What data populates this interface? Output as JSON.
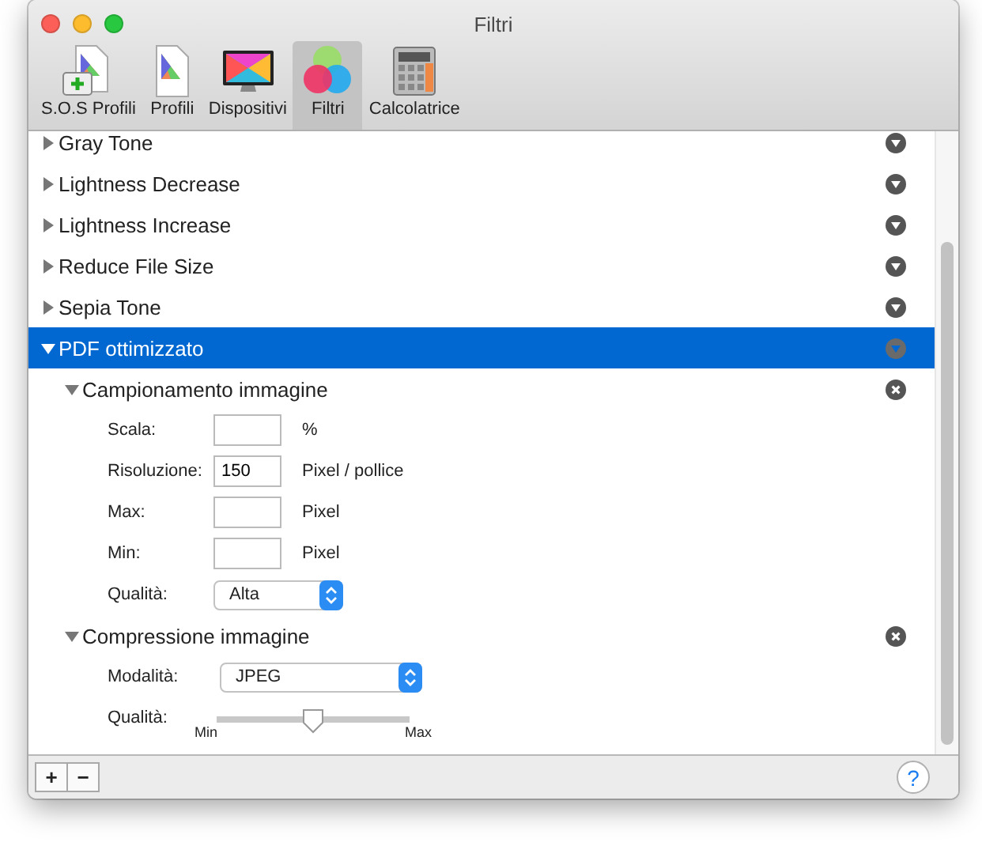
{
  "window": {
    "title": "Filtri"
  },
  "toolbar": {
    "items": [
      {
        "label": "S.O.S Profili",
        "kind": "sos",
        "selected": false
      },
      {
        "label": "Profili",
        "kind": "profile",
        "selected": false
      },
      {
        "label": "Dispositivi",
        "kind": "display",
        "selected": false
      },
      {
        "label": "Filtri",
        "kind": "filter",
        "selected": true
      },
      {
        "label": "Calcolatrice",
        "kind": "calc",
        "selected": false
      }
    ]
  },
  "filters": [
    {
      "name": "Gray Tone",
      "expanded": false,
      "selected": false
    },
    {
      "name": "Lightness Decrease",
      "expanded": false,
      "selected": false
    },
    {
      "name": "Lightness Increase",
      "expanded": false,
      "selected": false
    },
    {
      "name": "Reduce File Size",
      "expanded": false,
      "selected": false
    },
    {
      "name": "Sepia Tone",
      "expanded": false,
      "selected": false
    },
    {
      "name": "PDF ottimizzato",
      "expanded": true,
      "selected": true,
      "sections": [
        {
          "title": "Campionamento immagine",
          "expanded": true,
          "fields": [
            {
              "kind": "text",
              "label": "Scala:",
              "unit": "%"
            },
            {
              "kind": "text",
              "label": "Risoluzione:",
              "value": "150",
              "unit": "Pixel / pollice"
            },
            {
              "kind": "text",
              "label": "Max:",
              "unit": "Pixel"
            },
            {
              "kind": "text",
              "label": "Min:",
              "unit": "Pixel"
            },
            {
              "kind": "select",
              "label": "Qualità:",
              "value": "Alta"
            }
          ]
        },
        {
          "title": "Compressione immagine",
          "expanded": true,
          "fields": [
            {
              "kind": "popup",
              "label": "Modalità:",
              "value": "JPEG"
            },
            {
              "kind": "slider",
              "label": "Qualità:",
              "level": 0.5,
              "min_label": "Min",
              "max_label": "Max"
            }
          ]
        }
      ]
    }
  ],
  "bottom_bar": {
    "buttons": [
      "+",
      "−"
    ],
    "help": "?"
  }
}
